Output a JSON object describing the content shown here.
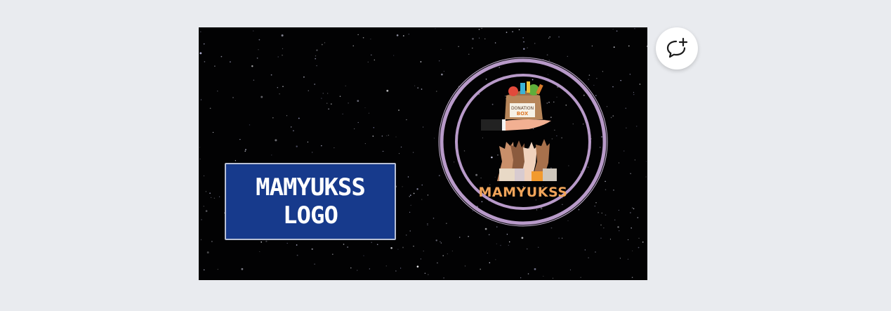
{
  "slide": {
    "title_line1": "MAMYUKSS",
    "title_line2": "LOGO",
    "logo_caption": "MAMYUKSS",
    "logo_box_text_1": "DONATION",
    "logo_box_text_2": "BOX"
  },
  "colors": {
    "page_background": "#e9ebef",
    "slide_background": "#020203",
    "title_box": "#173a8c",
    "ring": "#b89ac9",
    "logo_caption": "#f0a45a"
  },
  "icons": {
    "comment_button": "add-comment-icon"
  }
}
